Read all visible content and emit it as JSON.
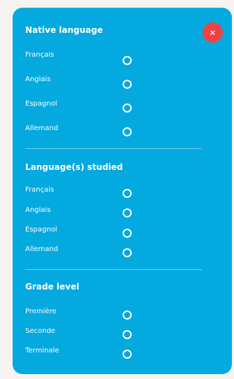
{
  "close": {
    "label": "×"
  },
  "sections": [
    {
      "title": "Native language",
      "options": [
        "Français",
        "Anglais",
        "Espagnol",
        "Allemand"
      ]
    },
    {
      "title": "Language(s) studied",
      "options": [
        "Français",
        "Anglais",
        "Espagnol",
        "Allemand"
      ]
    },
    {
      "title": "Grade level",
      "options": [
        "Première",
        "Seconde",
        "Terminale"
      ]
    }
  ],
  "colors": {
    "panel": "#04a9e0",
    "close_button": "#f04343",
    "text": "#ffffff",
    "page_background": "#f6f4f1"
  }
}
